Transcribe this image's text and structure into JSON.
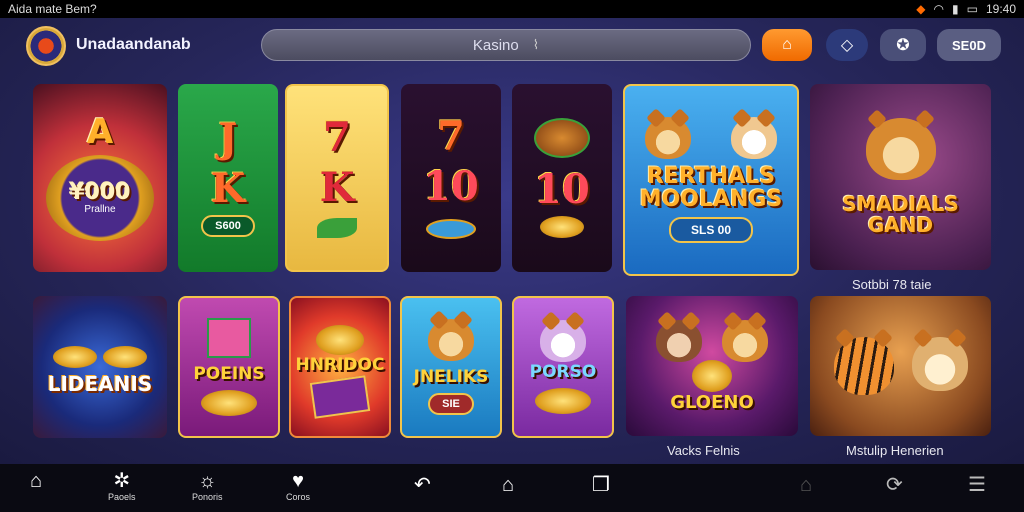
{
  "status": {
    "left_text": "Aida mate Bem?",
    "time": "19:40",
    "icons": [
      "alert-dot",
      "wifi-icon",
      "signal-icon",
      "battery-icon"
    ]
  },
  "header": {
    "title": "Unadaandanab",
    "search_text": "Kasino",
    "button_text": "SЕ0D",
    "icons": [
      "logo-icon",
      "mic-icon",
      "promo-icon",
      "chat-icon",
      "settings-icon"
    ]
  },
  "games_row1": [
    {
      "name": "A",
      "amount": "¥000",
      "sub": "Prallne"
    },
    {
      "sym1": "J",
      "sym2": "K",
      "pill": "S600"
    },
    {
      "sym1": "7",
      "sym2": "K"
    },
    {
      "sym1": "7",
      "sym2": "10"
    },
    {
      "sym1": "10"
    },
    {
      "title1": "RERTHALS",
      "title2": "MOOLANGS",
      "pill": "SLS 00"
    },
    {
      "title1": "SMADIALS",
      "title2": "GAND"
    }
  ],
  "caption_row1": "Sotbbi 78 taie",
  "games_row2": [
    {
      "title": "LIDEANIS"
    },
    {
      "title": "POEINS"
    },
    {
      "title": "HNRIDOC"
    },
    {
      "title": "JNELIKS",
      "pill": "SIE"
    },
    {
      "title": "PORSO"
    },
    {
      "title": "GLOENO"
    },
    {
      "title": ""
    }
  ],
  "captions_row2": [
    "Vacks Felnis",
    "Mstulip Henerien"
  ],
  "nav": {
    "items": [
      {
        "label": "",
        "icon": "home-icon"
      },
      {
        "label": "Paoels",
        "icon": "gear-icon"
      },
      {
        "label": "Ponoris",
        "icon": "bulb-icon"
      },
      {
        "label": "Coros",
        "icon": "heart-icon"
      }
    ],
    "system": [
      "back-icon",
      "house-outline-icon",
      "recents-icon",
      "home-alt-icon",
      "rotate-icon",
      "menu-icon"
    ]
  },
  "colors": {
    "accent": "#f06a00",
    "card_border": "#f2c44a",
    "bg": "#26265a"
  }
}
